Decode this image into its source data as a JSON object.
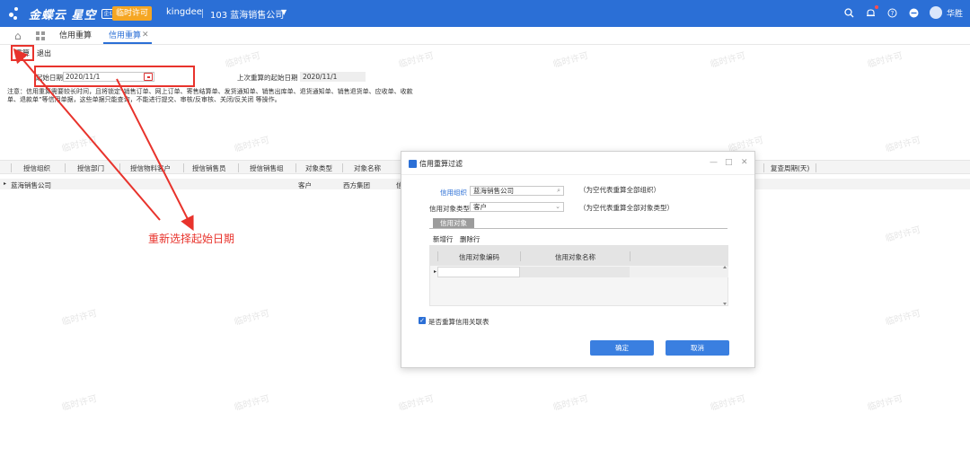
{
  "topbar": {
    "brand_name": "金蝶云 星空",
    "brand_badge": "企业版",
    "temp_license": "临时许可",
    "account": "kingdee",
    "org": "103 蓝海销售公司",
    "user_name": "华胜",
    "colors": {
      "bar": "#2b6fd6",
      "badge": "#f5a623"
    }
  },
  "tabs": [
    {
      "label": "信用重算"
    },
    {
      "label": "信用重算",
      "active": true
    }
  ],
  "toolbar": {
    "recalc": "重算",
    "exit": "退出"
  },
  "form": {
    "start_date_label": "起始日期",
    "start_date_value": "2020/11/1",
    "last_date_label": "上次重算的起始日期",
    "last_date_value": "2020/11/1",
    "note": "注意：信用重算需要较长时间，且将锁定“销售订单、网上订单、寄售结算单、发货通知单、销售出库单、退货通知单、销售退货单、应收单、收款单、退款单”等信用单据，这些单据只能查询，不能进行提交、审核/反审核、关闭/反关闭 等操作。"
  },
  "grid": {
    "columns": [
      "授信组织",
      "授信部门",
      "授信物料客户",
      "授信销售员",
      "授信销售组",
      "对象类型",
      "对象名称",
      "复查周期(天)"
    ],
    "row": {
      "org": "蓝海销售公司",
      "type": "客户",
      "name": "西方集团",
      "trunc": "信"
    }
  },
  "annotation": {
    "text": "重新选择起始日期",
    "color": "#e8332c"
  },
  "watermark": "临时许可",
  "dialog": {
    "title": "信用重算过滤",
    "credit_org_label": "信用组织",
    "credit_org_value": "蓝海销售公司",
    "credit_org_hint": "（为空代表重算全部组织）",
    "object_type_label": "信用对象类型",
    "object_type_value": "客户",
    "object_type_hint": "（为空代表重算全部对象类型）",
    "subtab": "信用对象",
    "add_row": "新增行",
    "delete_row": "删除行",
    "grid_columns": [
      "信用对象编码",
      "信用对象名称"
    ],
    "checkbox_label": "是否重算信用关联表",
    "checkbox_checked": true,
    "ok": "确定",
    "cancel": "取消"
  }
}
